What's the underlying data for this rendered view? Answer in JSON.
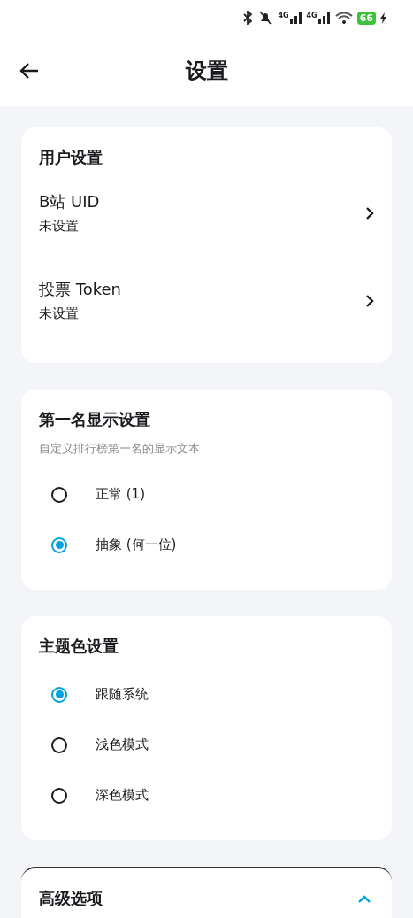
{
  "status_bar": {
    "network_1": "4G",
    "network_2": "4G",
    "battery": "66"
  },
  "header": {
    "title": "设置"
  },
  "sections": [
    {
      "kind": "links",
      "title": "用户设置",
      "items": [
        {
          "label": "B站 UID",
          "value": "未设置"
        },
        {
          "label": "投票 Token",
          "value": "未设置"
        }
      ]
    },
    {
      "kind": "radios",
      "title": "第一名显示设置",
      "subtitle": "自定义排行榜第一名的显示文本",
      "options": [
        {
          "label": "正常 (1)",
          "selected": false
        },
        {
          "label": "抽象 (何一位)",
          "selected": true
        }
      ]
    },
    {
      "kind": "radios",
      "title": "主题色设置",
      "options": [
        {
          "label": "跟随系统",
          "selected": true
        },
        {
          "label": "浅色模式",
          "selected": false
        },
        {
          "label": "深色模式",
          "selected": false
        }
      ]
    },
    {
      "kind": "expander",
      "title": "高级选项",
      "expanded": true
    }
  ]
}
